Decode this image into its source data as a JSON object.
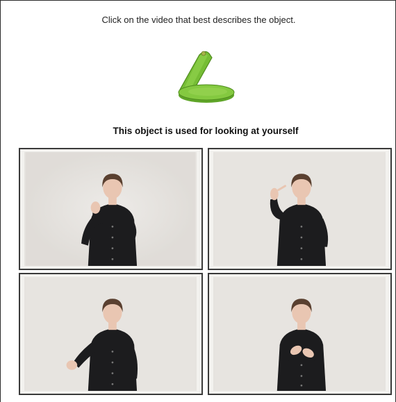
{
  "instruction": "Click on the video that best describes the object.",
  "object": {
    "icon": "green-compact-mirror-icon",
    "color": "#7cc23a"
  },
  "description": "This object is used for looking at yourself",
  "videos": [
    {
      "icon": "person-signing-video-1-icon"
    },
    {
      "icon": "person-signing-video-2-icon"
    },
    {
      "icon": "person-signing-video-3-icon"
    },
    {
      "icon": "person-signing-video-4-icon"
    }
  ],
  "colors": {
    "tile_border": "#3a3a3a",
    "backdrop": "#e6e3df",
    "clothing": "#1c1c1e",
    "skin": "#e9c6b2",
    "hair": "#5a4030"
  }
}
